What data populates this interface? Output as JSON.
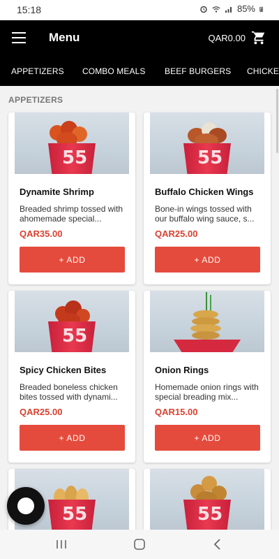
{
  "status_bar": {
    "time": "15:18",
    "battery": "85%"
  },
  "app_bar": {
    "title": "Menu",
    "cart_total": "QAR0.00"
  },
  "tabs": [
    {
      "label": "APPETIZERS"
    },
    {
      "label": "COMBO MEALS"
    },
    {
      "label": "BEEF BURGERS"
    },
    {
      "label": "CHICKEN"
    }
  ],
  "section": {
    "title": "APPETIZERS"
  },
  "products": [
    {
      "name": "Dynamite Shrimp",
      "description": "Breaded shrimp tossed with ahomemade special...",
      "price": "QAR35.00",
      "add_label": "+ ADD"
    },
    {
      "name": "Buffalo Chicken Wings",
      "description": "Bone-in wings tossed with our buffalo wing sauce, s...",
      "price": "QAR25.00",
      "add_label": "+ ADD"
    },
    {
      "name": "Spicy Chicken Bites",
      "description": "Breaded boneless chicken bites tossed with dynami...",
      "price": "QAR25.00",
      "add_label": "+ ADD"
    },
    {
      "name": "Onion Rings",
      "description": "Homemade onion rings with special breading mix...",
      "price": "QAR15.00",
      "add_label": "+ ADD"
    }
  ],
  "cup_label": "55",
  "colors": {
    "accent": "#e54b3c",
    "price": "#d9412f",
    "header": "#000000"
  },
  "icons": {
    "menu": "hamburger-icon",
    "cart": "cart-icon",
    "chat": "chat-bubble-icon",
    "nav_recent": "recent-apps-icon",
    "nav_home": "home-icon",
    "nav_back": "back-icon"
  }
}
